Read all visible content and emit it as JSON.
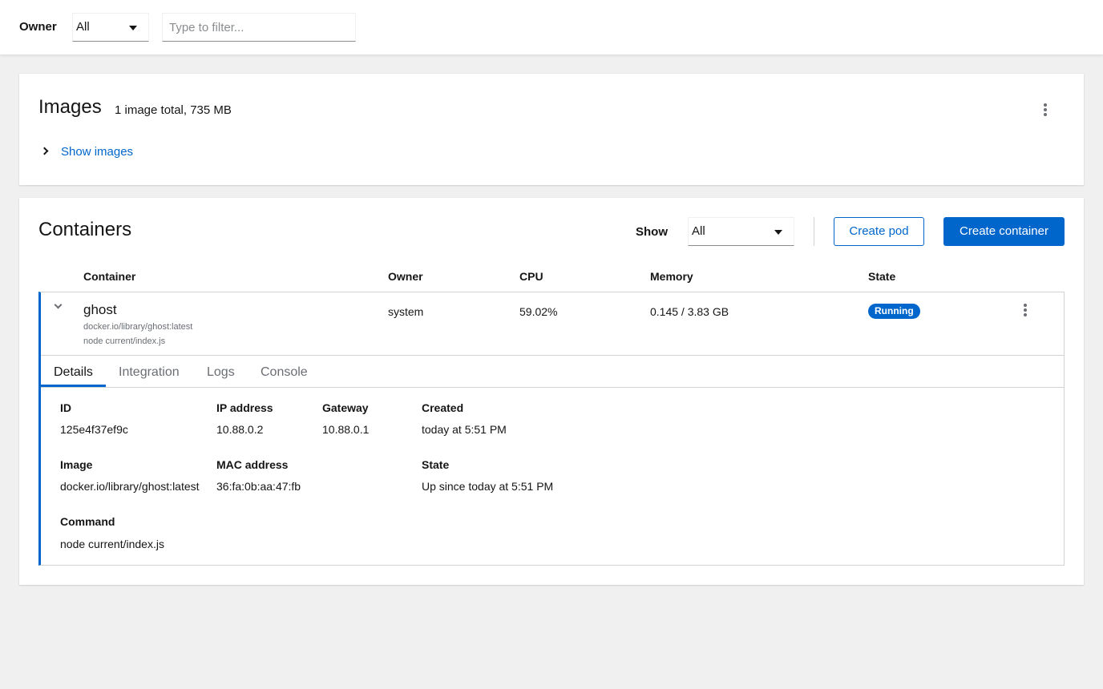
{
  "toolbar": {
    "owner_label": "Owner",
    "owner_value": "All",
    "filter_placeholder": "Type to filter..."
  },
  "images": {
    "title": "Images",
    "summary": "1 image total, 735 MB",
    "toggle_label": "Show images"
  },
  "containers": {
    "title": "Containers",
    "show_label": "Show",
    "show_value": "All",
    "create_pod_label": "Create pod",
    "create_container_label": "Create container",
    "columns": [
      "Container",
      "Owner",
      "CPU",
      "Memory",
      "State"
    ],
    "row": {
      "name": "ghost",
      "image": "docker.io/library/ghost:latest",
      "command": "node current/index.js",
      "owner": "system",
      "cpu": "59.02%",
      "memory": "0.145 / 3.83 GB",
      "state": "Running"
    },
    "tabs": [
      "Details",
      "Integration",
      "Logs",
      "Console"
    ],
    "details": {
      "id_label": "ID",
      "id_value": "125e4f37ef9c",
      "ip_label": "IP address",
      "ip_value": "10.88.0.2",
      "gateway_label": "Gateway",
      "gateway_value": "10.88.0.1",
      "created_label": "Created",
      "created_value": "today at 5:51 PM",
      "image_label": "Image",
      "image_value": "docker.io/library/ghost:latest",
      "mac_label": "MAC address",
      "mac_value": "36:fa:0b:aa:47:fb",
      "state_label": "State",
      "state_value": "Up since today at 5:51 PM",
      "command_label": "Command",
      "command_value": "node current/index.js"
    }
  },
  "colors": {
    "accent": "#0066cc",
    "page_bg": "#f0f0f0",
    "muted_text": "#6a6e73",
    "border": "#d2d2d2"
  }
}
